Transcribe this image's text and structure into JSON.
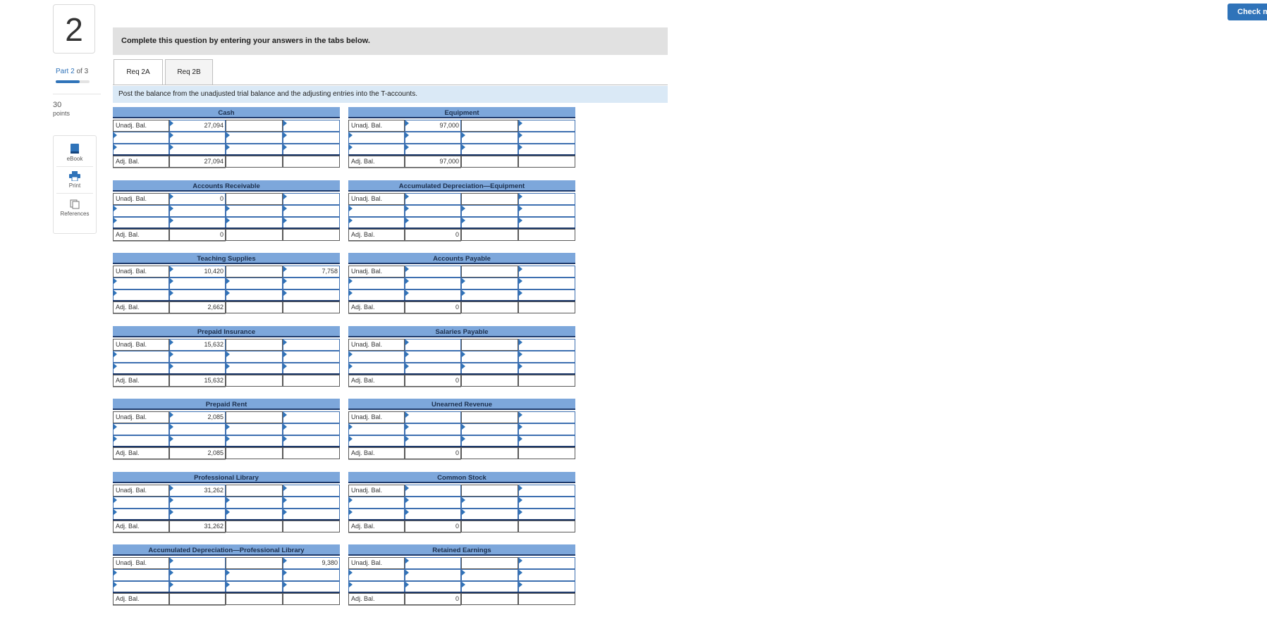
{
  "header": {
    "check_label": "Check my"
  },
  "left_rail": {
    "question_number": "2",
    "part_label_current": "Part 2",
    "part_label_total": "of 3",
    "points_value": "30",
    "points_label": "points",
    "tools": [
      {
        "label": "eBook",
        "icon": "book-icon"
      },
      {
        "label": "Print",
        "icon": "printer-icon"
      },
      {
        "label": "References",
        "icon": "references-icon"
      }
    ],
    "colors": {
      "accent": "#2f73b9"
    }
  },
  "main": {
    "banner": "Complete this question by entering your answers in the tabs below.",
    "tabs": [
      {
        "label": "Req 2A",
        "active": true
      },
      {
        "label": "Req 2B",
        "active": false
      }
    ],
    "instruction": "Post the balance from the unadjusted trial balance and the adjusting entries into the T-accounts."
  },
  "labels": {
    "unadj": "Unadj. Bal.",
    "adj": "Adj. Bal."
  },
  "colors": {
    "header_blue": "#7da7db",
    "input_arrow": "#2f73b9",
    "instruction_bg": "#dae9f6"
  },
  "accounts_left": [
    {
      "title": "Cash",
      "unadj_debit": "27,094",
      "unadj_credit": "",
      "adj_debit": "27,094",
      "adj_credit": ""
    },
    {
      "title": "Accounts Receivable",
      "unadj_debit": "0",
      "unadj_credit": "",
      "adj_debit": "0",
      "adj_credit": ""
    },
    {
      "title": "Teaching Supplies",
      "unadj_debit": "10,420",
      "unadj_credit": "7,758",
      "adj_debit": "2,662",
      "adj_credit": ""
    },
    {
      "title": "Prepaid Insurance",
      "unadj_debit": "15,632",
      "unadj_credit": "",
      "adj_debit": "15,632",
      "adj_credit": ""
    },
    {
      "title": "Prepaid Rent",
      "unadj_debit": "2,085",
      "unadj_credit": "",
      "adj_debit": "2,085",
      "adj_credit": ""
    },
    {
      "title": "Professional Library",
      "unadj_debit": "31,262",
      "unadj_credit": "",
      "adj_debit": "31,262",
      "adj_credit": ""
    },
    {
      "title": "Accumulated Depreciation—Professional Library",
      "unadj_debit": "",
      "unadj_credit": "9,380",
      "adj_debit": "",
      "adj_credit": ""
    }
  ],
  "accounts_right": [
    {
      "title": "Equipment",
      "unadj_debit": "97,000",
      "unadj_credit": "",
      "adj_debit": "97,000",
      "adj_credit": ""
    },
    {
      "title": "Accumulated Depreciation—Equipment",
      "unadj_debit": "",
      "unadj_credit": "",
      "adj_debit": "0",
      "adj_credit": ""
    },
    {
      "title": "Accounts Payable",
      "unadj_debit": "",
      "unadj_credit": "",
      "adj_debit": "0",
      "adj_credit": ""
    },
    {
      "title": "Salaries Payable",
      "unadj_debit": "",
      "unadj_credit": "",
      "adj_debit": "0",
      "adj_credit": ""
    },
    {
      "title": "Unearned Revenue",
      "unadj_debit": "",
      "unadj_credit": "",
      "adj_debit": "0",
      "adj_credit": ""
    },
    {
      "title": "Common Stock",
      "unadj_debit": "",
      "unadj_credit": "",
      "adj_debit": "0",
      "adj_credit": ""
    },
    {
      "title": "Retained Earnings",
      "unadj_debit": "",
      "unadj_credit": "",
      "adj_debit": "0",
      "adj_credit": ""
    }
  ]
}
